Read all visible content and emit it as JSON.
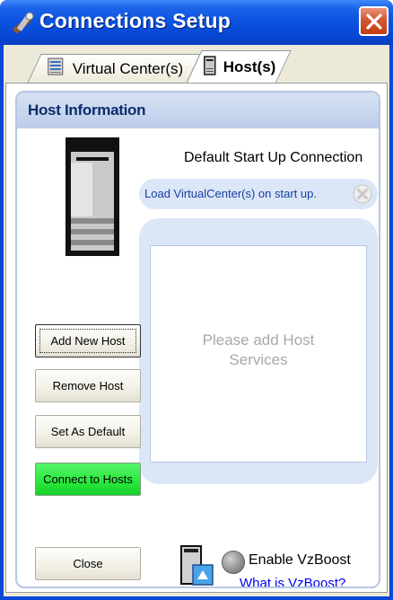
{
  "window": {
    "title": "Connections Setup",
    "icons": {
      "app": "wrench-screwdriver-icon",
      "close": "close-icon"
    }
  },
  "tabs": [
    {
      "label": "Virtual Center(s)",
      "icon": "server-rack-icon",
      "selected": false
    },
    {
      "label": "Host(s)",
      "icon": "host-server-icon",
      "selected": true
    }
  ],
  "panel": {
    "title": "Host Information",
    "default_label": "Default Start Up Connection",
    "load_option": "Load VirtualCenter(s) on start up.",
    "empty_message_line1": "Please add Host",
    "empty_message_line2": "Services"
  },
  "buttons": {
    "add": "Add New Host",
    "remove": "Remove Host",
    "set_default": "Set As Default",
    "connect": "Connect to Hosts",
    "close": "Close"
  },
  "vzboost": {
    "label": "Enable VzBoost",
    "link": "What is VzBoost?",
    "enabled": false
  },
  "colors": {
    "titlebar": "#0a52e0",
    "connect_button": "#28e83c",
    "panel_header": "#bccde9",
    "link": "#0000ee"
  }
}
